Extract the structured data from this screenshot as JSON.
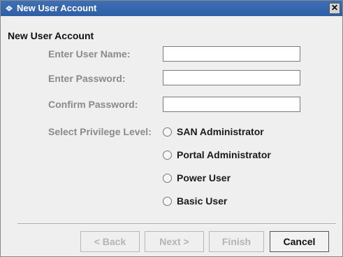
{
  "window": {
    "title": "New User Account",
    "close_glyph": "✕"
  },
  "form": {
    "heading": "New User Account",
    "username": {
      "label": "Enter User Name:",
      "value": ""
    },
    "password": {
      "label": "Enter Password:",
      "value": ""
    },
    "confirm_password": {
      "label": "Confirm Password:",
      "value": ""
    },
    "privilege": {
      "label": "Select Privilege Level:",
      "options": [
        {
          "label": "SAN Administrator",
          "selected": false
        },
        {
          "label": "Portal Administrator",
          "selected": false
        },
        {
          "label": "Power User",
          "selected": false
        },
        {
          "label": "Basic User",
          "selected": false
        }
      ]
    }
  },
  "buttons": {
    "back": {
      "label": "< Back",
      "enabled": false
    },
    "next": {
      "label": "Next >",
      "enabled": false
    },
    "finish": {
      "label": "Finish",
      "enabled": false
    },
    "cancel": {
      "label": "Cancel",
      "enabled": true
    }
  },
  "colors": {
    "titlebar": "#3f6fb5",
    "background": "#efefef",
    "disabled_text": "#8a8a8a"
  },
  "icons": {
    "title": "java-coffee-cup-icon",
    "close": "close-icon",
    "radio": "radio-unselected-icon"
  }
}
